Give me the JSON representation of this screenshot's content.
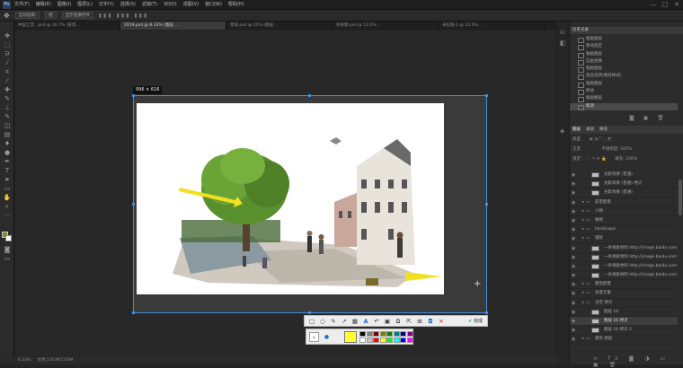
{
  "menubar": {
    "logo": "Ps",
    "items": [
      "文件(F)",
      "编辑(E)",
      "图像(I)",
      "图层(L)",
      "文字(Y)",
      "选择(S)",
      "滤镜(T)",
      "3D(D)",
      "视图(V)",
      "窗口(W)",
      "帮助(H)"
    ],
    "window_controls": [
      "—",
      "□",
      "✕"
    ]
  },
  "options_bar": {
    "items": [
      "自动选择:",
      "组",
      "显示变换控件"
    ]
  },
  "doc_tabs": [
    {
      "label": "中国江苏…psd @ 16.7% (背景…",
      "active": false
    },
    {
      "label": "2019.psd @ 8.33% (图层…",
      "active": true
    },
    {
      "label": "景观.psd @ 25% (图层…",
      "active": false
    },
    {
      "label": "效果图.psd @ 12.5%…",
      "active": false
    },
    {
      "label": "未标题-1 @ 33.3%…",
      "active": false
    }
  ],
  "capture": {
    "dimensions_label": "996 × 616",
    "done_label": "完成",
    "colors": [
      "#000000",
      "#808080",
      "#7f0000",
      "#808000",
      "#007f00",
      "#007f7f",
      "#00007f",
      "#7f007f",
      "#ffffff",
      "#c0c0c0",
      "#ff0000",
      "#ffff00",
      "#00ff00",
      "#00ffff",
      "#0000ff",
      "#ff00ff"
    ],
    "active_color": "#ffff33"
  },
  "history": {
    "title": "历史记录",
    "items": [
      "粘贴图层",
      "移动选区",
      "粘贴图层",
      "自由变换",
      "粘贴图层",
      "混合选项(图层样式)",
      "粘贴图层",
      "移动",
      "粘贴图层",
      "取消"
    ],
    "active_index": 9
  },
  "layers": {
    "tabs": [
      "图层",
      "通道",
      "路径"
    ],
    "kind_label": "类型",
    "blend": "正常",
    "opacity": "不透明度: 100%",
    "fill": "填充: 100%",
    "lock": "锁定:",
    "items": [
      {
        "name": "光影效果 (普通)",
        "kind": "layer"
      },
      {
        "name": "光影效果 (普通) 拷贝",
        "kind": "layer"
      },
      {
        "name": "光影效果 (普通)",
        "kind": "layer"
      },
      {
        "name": "前景配景",
        "kind": "group"
      },
      {
        "name": "人物",
        "kind": "group"
      },
      {
        "name": "植物",
        "kind": "group"
      },
      {
        "name": "landscape",
        "kind": "group"
      },
      {
        "name": "铺装",
        "kind": "group"
      },
      {
        "name": "一条线索材料 http://image.baidu.com",
        "kind": "layer"
      },
      {
        "name": "一条线索材料 http://image.baidu.com",
        "kind": "layer"
      },
      {
        "name": "一条线索材料 http://image.baidu.com",
        "kind": "layer"
      },
      {
        "name": "一条线索材料 http://image.baidu.com",
        "kind": "layer"
      },
      {
        "name": "建筑配景",
        "kind": "group"
      },
      {
        "name": "背景元素",
        "kind": "group"
      },
      {
        "name": "天空 拷贝",
        "kind": "group"
      },
      {
        "name": "图层 16",
        "kind": "layer"
      },
      {
        "name": "图层 16 拷贝",
        "kind": "layer"
      },
      {
        "name": "图层 16 拷贝 2",
        "kind": "layer"
      },
      {
        "name": "建筑 图层",
        "kind": "group"
      }
    ],
    "selected_index": 16
  },
  "status": {
    "zoom": "8.33%",
    "doc": "文档:2.81M/5.02M"
  }
}
